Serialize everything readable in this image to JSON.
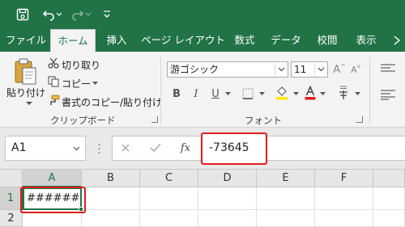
{
  "colors": {
    "brand": "#217346",
    "highlight": "#e01d1d"
  },
  "qat": {
    "save_icon": "save-icon",
    "undo_icon": "undo-icon",
    "redo_icon": "redo-icon",
    "customize_icon": "customize-qat-icon"
  },
  "tabs": [
    {
      "label": "ファイル",
      "active": false
    },
    {
      "label": "ホーム",
      "active": true
    },
    {
      "label": "挿入",
      "active": false
    },
    {
      "label": "ページ レイアウト",
      "active": false
    },
    {
      "label": "数式",
      "active": false
    },
    {
      "label": "データ",
      "active": false
    },
    {
      "label": "校閲",
      "active": false
    },
    {
      "label": "表示",
      "active": false
    }
  ],
  "clipboard": {
    "paste_label": "貼り付け",
    "cut_label": "切り取り",
    "copy_label": "コピー",
    "format_painter_label": "書式のコピー/貼り付け",
    "group_label": "クリップボード"
  },
  "font": {
    "font_name": "游ゴシック",
    "font_size": "11",
    "bold": "B",
    "italic": "I",
    "underline": "U",
    "group_label": "フォント"
  },
  "formula_bar": {
    "name_box": "A1",
    "value": "-73645",
    "fx_label": "fx"
  },
  "sheet": {
    "columns": [
      "A",
      "B",
      "C",
      "D",
      "E",
      "F"
    ],
    "rows": [
      "1",
      "2"
    ],
    "cell_a1": "#######"
  }
}
